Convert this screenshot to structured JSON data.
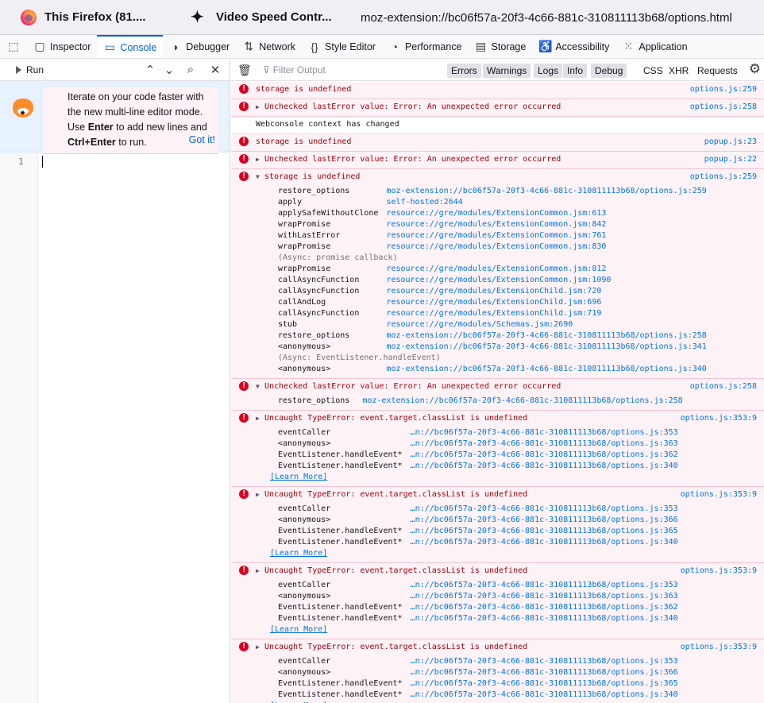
{
  "browser_tabs": [
    {
      "title": "This Firefox (81....",
      "icon": "firefox-icon"
    },
    {
      "title": "Video Speed Contr...",
      "icon": "puzzle-icon"
    }
  ],
  "url": "moz-extension://bc06f57a-20f3-4c66-881c-310811113b68/options.html",
  "toolbox_tabs": [
    {
      "label": "Inspector",
      "icon": "inspector-icon"
    },
    {
      "label": "Console",
      "icon": "console-icon",
      "selected": true
    },
    {
      "label": "Debugger",
      "icon": "debugger-icon"
    },
    {
      "label": "Network",
      "icon": "network-icon"
    },
    {
      "label": "Style Editor",
      "icon": "style-editor-icon"
    },
    {
      "label": "Performance",
      "icon": "performance-icon"
    },
    {
      "label": "Storage",
      "icon": "storage-icon"
    },
    {
      "label": "Accessibility",
      "icon": "accessibility-icon"
    },
    {
      "label": "Application",
      "icon": "application-icon"
    }
  ],
  "editor": {
    "run_label": "Run",
    "tip_part1": "Iterate on your code faster with the new multi-line editor mode. Use ",
    "tip_enter": "Enter",
    "tip_part2": " to add new lines and ",
    "tip_ctrl_enter": "Ctrl+Enter",
    "tip_part3": " to run.",
    "got_it": "Got it!",
    "line_number": "1"
  },
  "filter": {
    "placeholder": "Filter Output",
    "levels": [
      "Errors",
      "Warnings",
      "Logs",
      "Info",
      "Debug"
    ],
    "extras": [
      "CSS",
      "XHR",
      "Requests"
    ]
  },
  "messages": [
    {
      "text": "storage is undefined",
      "location": "options.js:259"
    },
    {
      "text": "Unchecked lastError value: Error: An unexpected error occurred",
      "location": "options.js:258",
      "toggle": "▶"
    },
    {
      "text": "Webconsole context has changed",
      "location": "",
      "plain": true
    },
    {
      "text": "storage is undefined",
      "location": "popup.js:23"
    },
    {
      "text": "Unchecked lastError value: Error: An unexpected error occurred",
      "location": "popup.js:22",
      "toggle": "▶"
    },
    {
      "text": "storage is undefined",
      "location": "options.js:259",
      "toggle": "▼",
      "trace": [
        {
          "fn": "restore_options",
          "src": "moz-extension://bc06f57a-20f3-4c66-881c-310811113b68/options.js:259"
        },
        {
          "fn": "apply",
          "src": "self-hosted:2644"
        },
        {
          "fn": "applySafeWithoutClone",
          "src": "resource://gre/modules/ExtensionCommon.jsm:613"
        },
        {
          "fn": "wrapPromise",
          "src": "resource://gre/modules/ExtensionCommon.jsm:842"
        },
        {
          "fn": "withLastError",
          "src": "resource://gre/modules/ExtensionCommon.jsm:761"
        },
        {
          "fn": "wrapPromise",
          "src": "resource://gre/modules/ExtensionCommon.jsm:830"
        },
        {
          "async": "(Async: promise callback)"
        },
        {
          "fn": "wrapPromise",
          "src": "resource://gre/modules/ExtensionCommon.jsm:812"
        },
        {
          "fn": "callAsyncFunction",
          "src": "resource://gre/modules/ExtensionCommon.jsm:1090"
        },
        {
          "fn": "callAsyncFunction",
          "src": "resource://gre/modules/ExtensionChild.jsm:720"
        },
        {
          "fn": "callAndLog",
          "src": "resource://gre/modules/ExtensionChild.jsm:696"
        },
        {
          "fn": "callAsyncFunction",
          "src": "resource://gre/modules/ExtensionChild.jsm:719"
        },
        {
          "fn": "stub",
          "src": "resource://gre/modules/Schemas.jsm:2690"
        },
        {
          "fn": "restore_options",
          "src": "moz-extension://bc06f57a-20f3-4c66-881c-310811113b68/options.js:258"
        },
        {
          "fn": "<anonymous>",
          "src": "moz-extension://bc06f57a-20f3-4c66-881c-310811113b68/options.js:341"
        },
        {
          "async": "(Async: EventListener.handleEvent)"
        },
        {
          "fn": "<anonymous>",
          "src": "moz-extension://bc06f57a-20f3-4c66-881c-310811113b68/options.js:340"
        }
      ]
    },
    {
      "text": "Unchecked lastError value: Error: An unexpected error occurred",
      "location": "options.js:258",
      "toggle": "▼",
      "trace": [
        {
          "fn": "restore_options ",
          "src": "moz-extension://bc06f57a-20f3-4c66-881c-310811113b68/options.js:258"
        }
      ]
    },
    {
      "text": "Uncaught TypeError: event.target.classList is undefined",
      "location": "options.js:353:9",
      "toggle": "▶",
      "learn": "[Learn More]",
      "trace": [
        {
          "fn": "eventCaller",
          "src": "…n://bc06f57a-20f3-4c66-881c-310811113b68/options.js:353"
        },
        {
          "fn": "<anonymous>",
          "src": "…n://bc06f57a-20f3-4c66-881c-310811113b68/options.js:363"
        },
        {
          "fn": "EventListener.handleEvent*",
          "src": "…n://bc06f57a-20f3-4c66-881c-310811113b68/options.js:362"
        },
        {
          "fn": "EventListener.handleEvent*",
          "src": "…n://bc06f57a-20f3-4c66-881c-310811113b68/options.js:340"
        }
      ]
    },
    {
      "text": "Uncaught TypeError: event.target.classList is undefined",
      "location": "options.js:353:9",
      "toggle": "▶",
      "learn": "[Learn More]",
      "trace": [
        {
          "fn": "eventCaller",
          "src": "…n://bc06f57a-20f3-4c66-881c-310811113b68/options.js:353"
        },
        {
          "fn": "<anonymous>",
          "src": "…n://bc06f57a-20f3-4c66-881c-310811113b68/options.js:366"
        },
        {
          "fn": "EventListener.handleEvent*",
          "src": "…n://bc06f57a-20f3-4c66-881c-310811113b68/options.js:365"
        },
        {
          "fn": "EventListener.handleEvent*",
          "src": "…n://bc06f57a-20f3-4c66-881c-310811113b68/options.js:340"
        }
      ]
    },
    {
      "text": "Uncaught TypeError: event.target.classList is undefined",
      "location": "options.js:353:9",
      "toggle": "▶",
      "learn": "[Learn More]",
      "trace": [
        {
          "fn": "eventCaller",
          "src": "…n://bc06f57a-20f3-4c66-881c-310811113b68/options.js:353"
        },
        {
          "fn": "<anonymous>",
          "src": "…n://bc06f57a-20f3-4c66-881c-310811113b68/options.js:363"
        },
        {
          "fn": "EventListener.handleEvent*",
          "src": "…n://bc06f57a-20f3-4c66-881c-310811113b68/options.js:362"
        },
        {
          "fn": "EventListener.handleEvent*",
          "src": "…n://bc06f57a-20f3-4c66-881c-310811113b68/options.js:340"
        }
      ]
    },
    {
      "text": "Uncaught TypeError: event.target.classList is undefined",
      "location": "options.js:353:9",
      "toggle": "▶",
      "learn": "[Learn More]",
      "trace": [
        {
          "fn": "eventCaller",
          "src": "…n://bc06f57a-20f3-4c66-881c-310811113b68/options.js:353"
        },
        {
          "fn": "<anonymous>",
          "src": "…n://bc06f57a-20f3-4c66-881c-310811113b68/options.js:366"
        },
        {
          "fn": "EventListener.handleEvent*",
          "src": "…n://bc06f57a-20f3-4c66-881c-310811113b68/options.js:365"
        },
        {
          "fn": "EventListener.handleEvent*",
          "src": "…n://bc06f57a-20f3-4c66-881c-310811113b68/options.js:340"
        }
      ]
    }
  ],
  "colors": {
    "accent": "#0061e0",
    "error": "#d70022",
    "error_bg": "#fdf2f5",
    "link": "#0074e8"
  }
}
